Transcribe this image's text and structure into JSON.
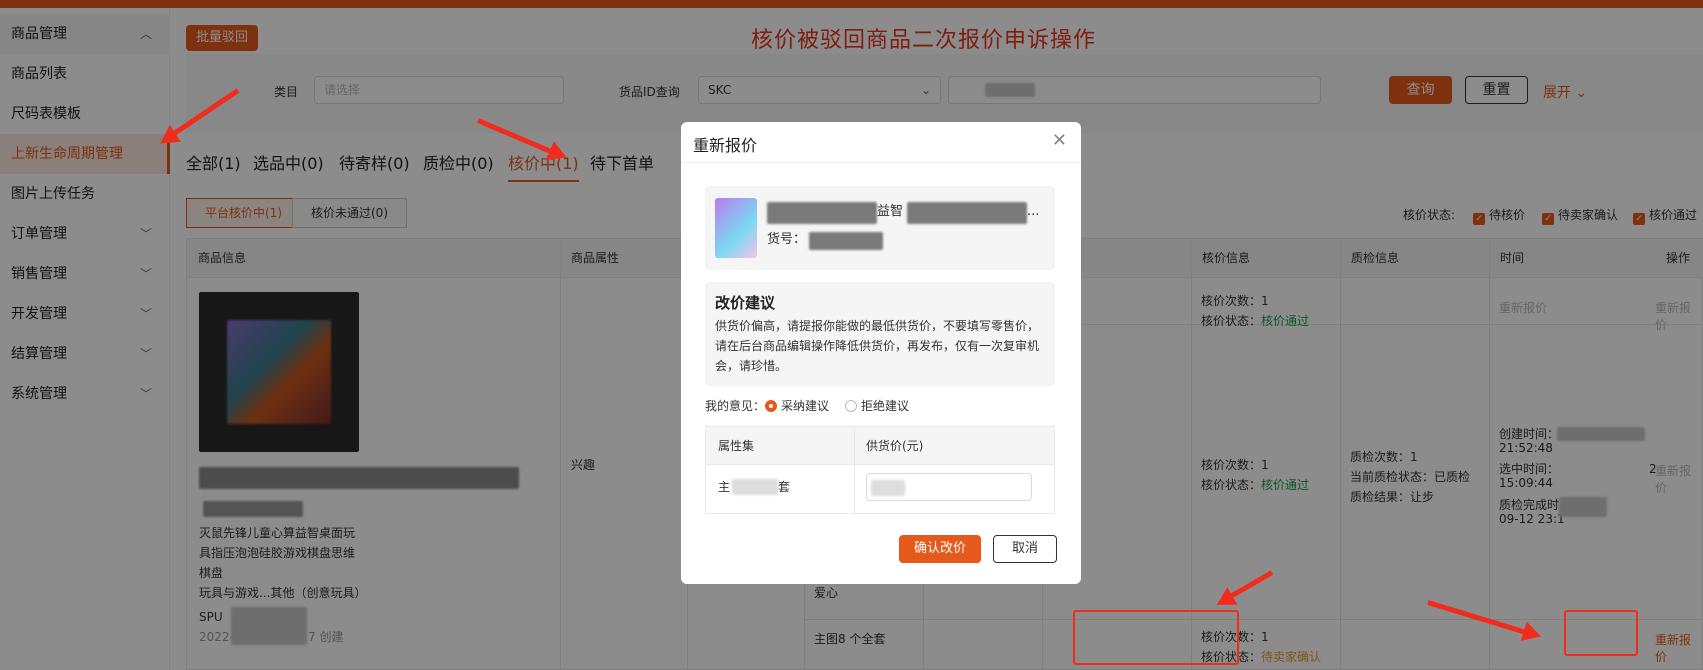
{
  "sidebar": {
    "items": [
      {
        "label": "商品管理",
        "chev": "^"
      },
      {
        "label": "商品列表"
      },
      {
        "label": "尺码表模板"
      },
      {
        "label": "上新生命周期管理"
      },
      {
        "label": "图片上传任务"
      },
      {
        "label": "订单管理",
        "chev": "v"
      },
      {
        "label": "销售管理",
        "chev": "v"
      },
      {
        "label": "开发管理",
        "chev": "v"
      },
      {
        "label": "结算管理",
        "chev": "v"
      },
      {
        "label": "系统管理",
        "chev": "v"
      }
    ]
  },
  "toolbar": {
    "batch_reject": "批量驳回"
  },
  "banner": "核价被驳回商品二次报价申诉操作",
  "filter": {
    "category_label": "类目",
    "category_placeholder": "请选择",
    "id_label": "货品ID查询",
    "id_type": "SKC",
    "query": "查询",
    "reset": "重置",
    "expand": "展开"
  },
  "tabs": [
    "全部(1)",
    "选品中(0)",
    "待寄样(0)",
    "质检中(0)",
    "核价中(1)",
    "待下首单"
  ],
  "subtabs": [
    "平台核价中(1)",
    "核价未通过(0)"
  ],
  "status_filter": {
    "label": "核价状态:",
    "options": [
      "待核价",
      "待卖家确认",
      "核价通过"
    ]
  },
  "table": {
    "headers": [
      "商品信息",
      "商品属性",
      "核价信息",
      "质检信息",
      "时间",
      "操作"
    ],
    "product_title": [
      "灭鼠先锋儿童心算益智桌面玩",
      "具指压泡泡硅胶游戏棋盘思维",
      "棋盘"
    ],
    "product_category": "玩具与游戏...其他（创意玩具）",
    "spu_prefix": "SPU",
    "created_prefix": "2022-",
    "created_suffix": "7 创建",
    "attr_value": "兴趣",
    "attr_love": "爱心",
    "attr_main": "主图8 个全套",
    "price_rows": [
      {
        "count": "核价次数：1",
        "status_label": "核价状态：",
        "status": "核价通过"
      },
      {
        "count": "核价次数：1",
        "status_label": "核价状态：",
        "status": "核价通过"
      },
      {
        "count": "核价次数：1",
        "status_label": "核价状态：",
        "status": "待卖家确认"
      }
    ],
    "qc": {
      "count": "质检次数：1",
      "state": "当前质检状态：已质检",
      "result": "质检结果：让步"
    },
    "time": {
      "created": "创建时间：202",
      "created_time": "21:52:48",
      "selected": "选中时间：",
      "selected_suffix": "2",
      "selected_time": "15:09:44",
      "qc_done": "质检完成时",
      "qc_done_time": "09-12 23:1"
    },
    "action": "重新报价"
  },
  "modal": {
    "title": "重新报价",
    "product_name_visible": "益智",
    "product_name_suffix": "...",
    "sku_label": "货号：",
    "suggest_title": "改价建议",
    "suggest_text": "供货价偏高，请提报你能做的最低供货价，不要填写零售价，请在后台商品编辑操作降低供货价，再发布，仅有一次复审机会，请珍惜。",
    "opinion_label": "我的意见：",
    "accept": "采纳建议",
    "reject": "拒绝建议",
    "col_attr": "属性集",
    "col_price": "供货价(元)",
    "row_attr_a": "主",
    "row_attr_b": "套",
    "confirm": "确认改价",
    "cancel": "取消"
  }
}
